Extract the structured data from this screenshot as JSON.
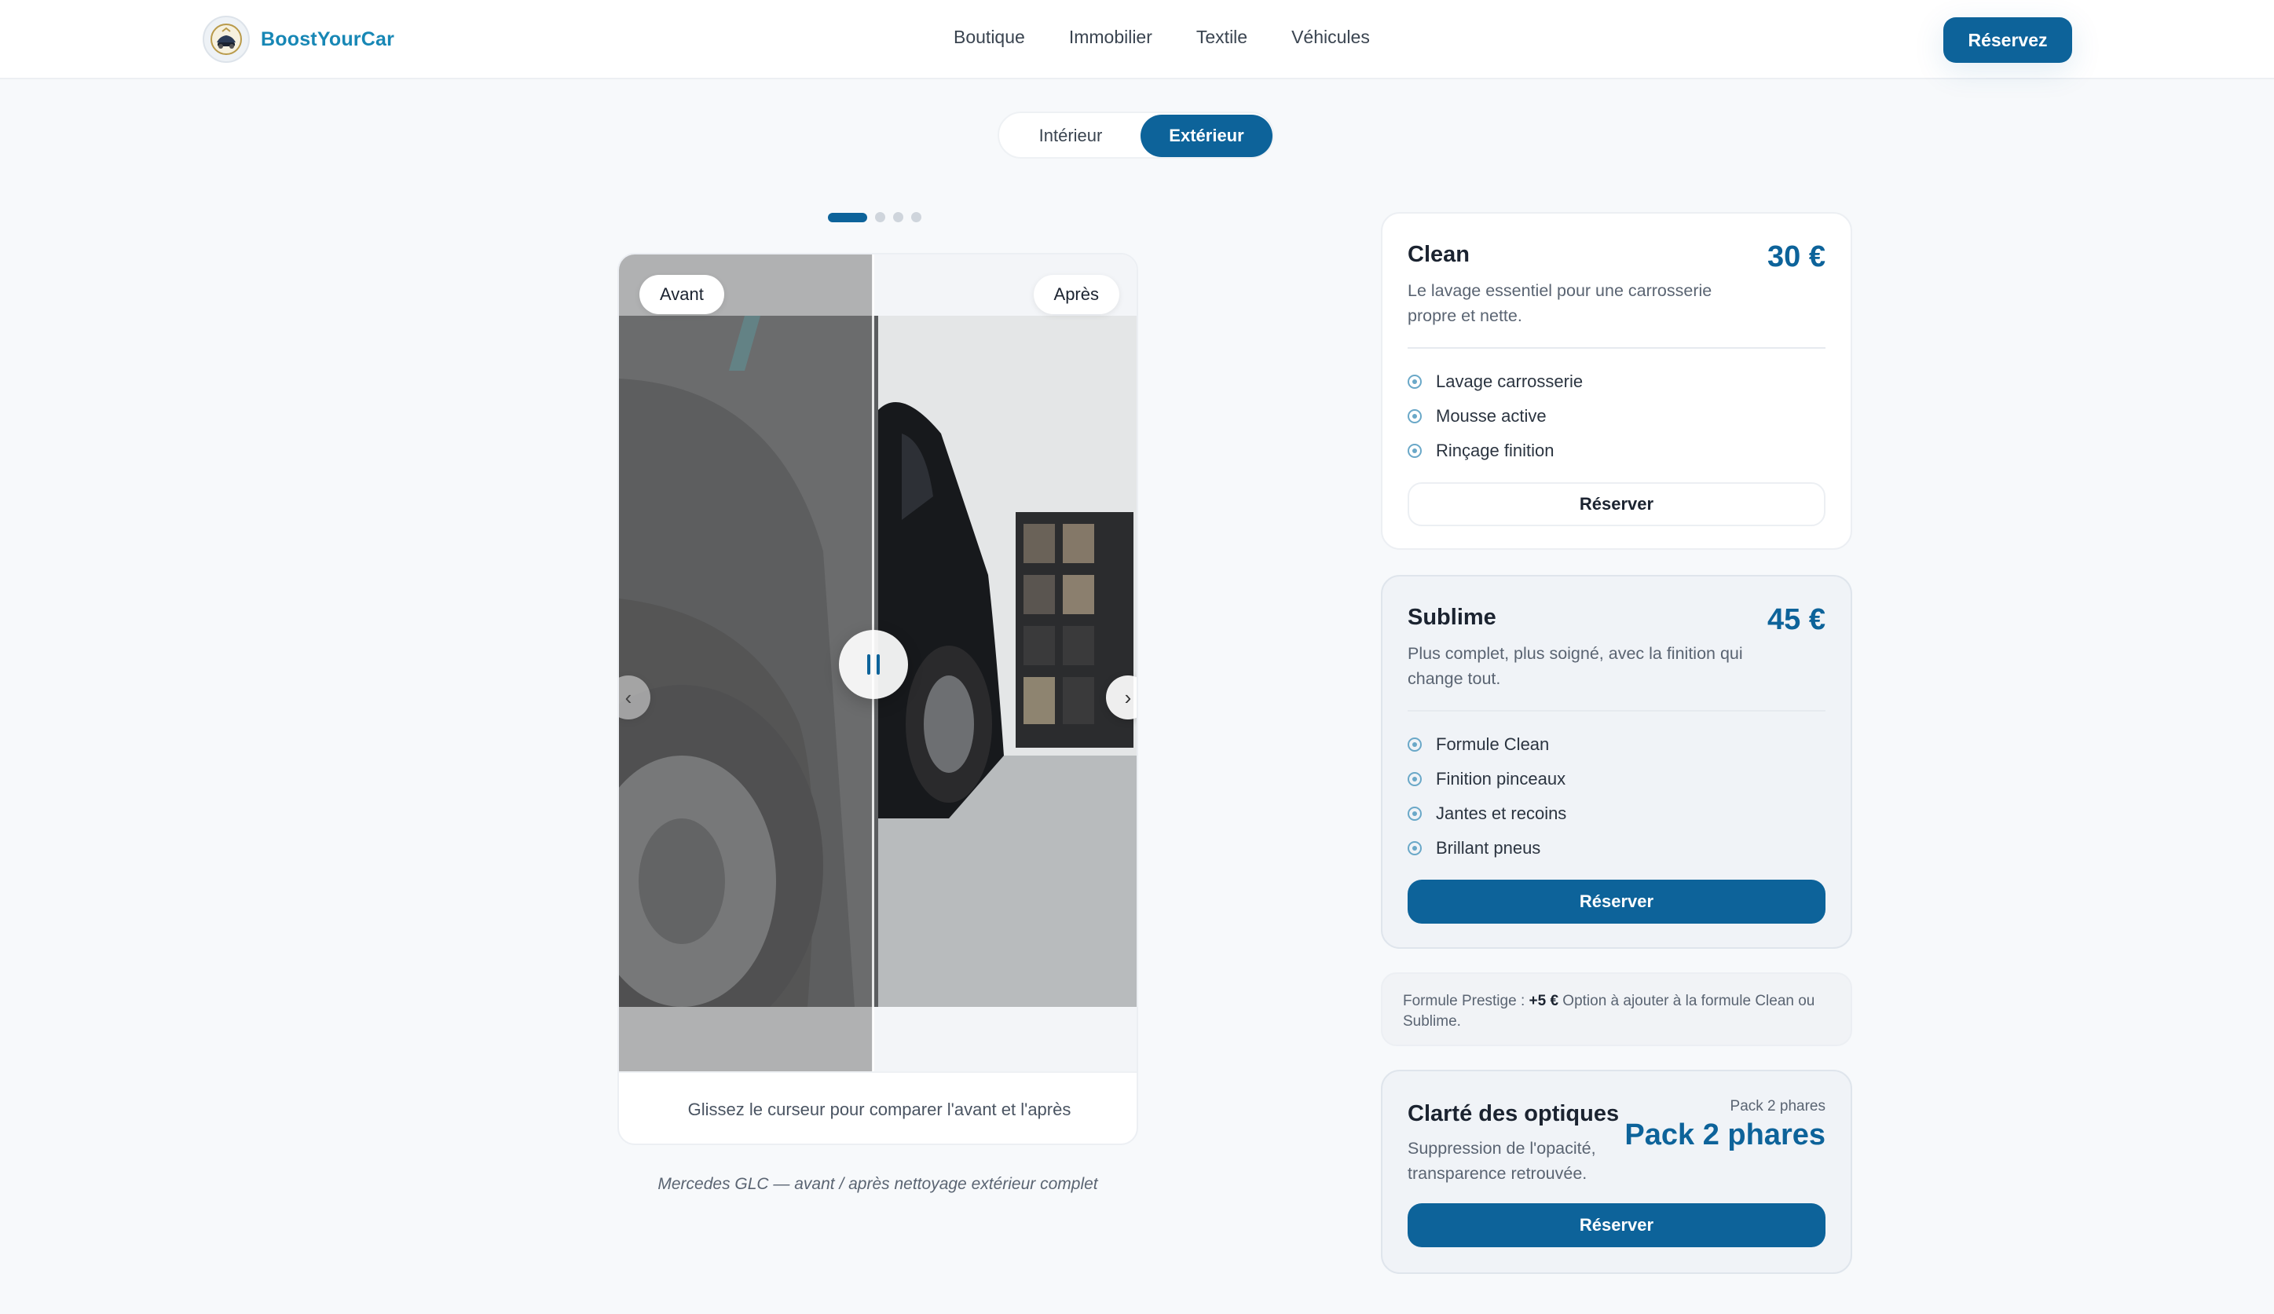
{
  "header": {
    "brand": "BoostYourCar",
    "nav": [
      "Boutique",
      "Immobilier",
      "Textile",
      "Véhicules"
    ],
    "cta": "Réservez"
  },
  "toggle": {
    "interior": "Intérieur",
    "exterior": "Extérieur",
    "selected": "Extérieur"
  },
  "carousel": {
    "count": 4,
    "active": 1
  },
  "compare": {
    "before_label": "Avant",
    "after_label": "Après",
    "hint": "Glissez le curseur pour comparer l'avant et l'après",
    "caption": "Mercedes GLC — avant / après nettoyage extérieur complet",
    "slider_position_fraction": 0.49
  },
  "plans": [
    {
      "title": "Clean",
      "price": "30 €",
      "description": "Le lavage essentiel pour une carrosserie propre et nette.",
      "features": [
        "Lavage carrosserie",
        "Mousse active",
        "Rinçage finition"
      ],
      "button": "Réserver"
    },
    {
      "title": "Sublime",
      "price": "45 €",
      "description": "Plus complet, plus soigné, avec la finition qui change tout.",
      "features": [
        "Formule Clean",
        "Finition pinceaux",
        "Jantes et recoins",
        "Brillant pneus"
      ],
      "button": "Réserver"
    }
  ],
  "prestige_note": {
    "prefix": "Formule Prestige : ",
    "amount": "+5 €",
    "text": " Option à ajouter à la formule Clean ou Sublime."
  },
  "optics": {
    "title": "Clarté des optiques",
    "small_label": "Pack 2 phares",
    "big_label": "Pack 2 phares",
    "description": "Suppression de l'opacité, transparence retrouvée.",
    "button": "Réserver"
  },
  "colors": {
    "primary": "#0d639a",
    "brand": "#1787b5"
  }
}
